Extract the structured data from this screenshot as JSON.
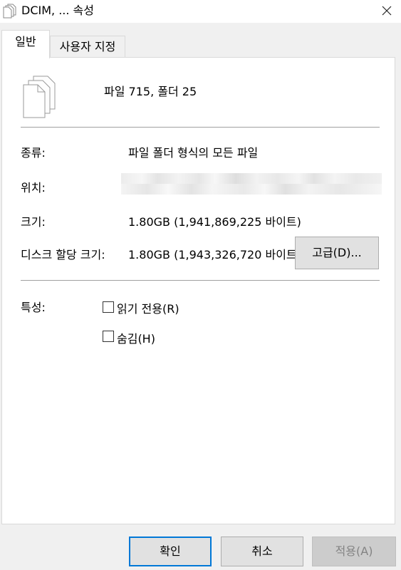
{
  "window": {
    "title": "DCIM, ... 속성",
    "icon": "documents-icon",
    "close_icon": "close-icon"
  },
  "tabs": [
    {
      "label": "일반",
      "active": true
    },
    {
      "label": "사용자 지정",
      "active": false
    }
  ],
  "general": {
    "summary": "파일 715, 폴더 25",
    "type_label": "종류:",
    "type_value": "파일 폴더 형식의 모든 파일",
    "location_label": "위치:",
    "location_value": "",
    "size_label": "크기:",
    "size_value": "1.80GB (1,941,869,225 바이트)",
    "disk_size_label": "디스크 할당 크기:",
    "disk_size_value": "1.80GB (1,943,326,720 바이트)",
    "attributes_label": "특성:",
    "readonly_label": "읽기 전용(R)",
    "readonly_checked": false,
    "hidden_label": "숨김(H)",
    "hidden_checked": false,
    "advanced_button": "고급(D)..."
  },
  "footer": {
    "ok": "확인",
    "cancel": "취소",
    "apply": "적용(A)",
    "apply_enabled": false,
    "accent_color": "#0078d7"
  }
}
